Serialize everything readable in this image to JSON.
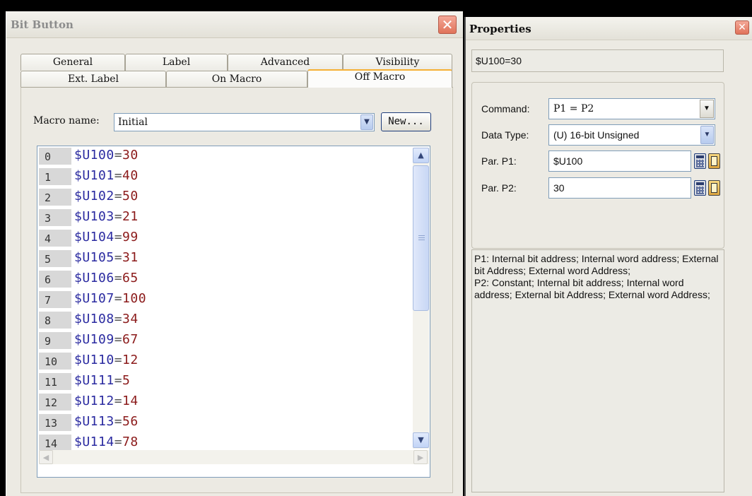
{
  "bit_button_dialog": {
    "title": "Bit Button",
    "tabs_row1": [
      "General",
      "Label",
      "Advanced",
      "Visibility"
    ],
    "tabs_row2": [
      "Ext. Label",
      "On Macro",
      "Off Macro"
    ],
    "active_tab": "Off Macro",
    "macro_name_label": "Macro name:",
    "macro_name_value": "Initial",
    "new_button_label": "New...",
    "macro_lines": [
      {
        "num": "0",
        "var": "$U100",
        "op": "=",
        "val": "30"
      },
      {
        "num": "1",
        "var": "$U101",
        "op": "=",
        "val": "40"
      },
      {
        "num": "2",
        "var": "$U102",
        "op": "=",
        "val": "50"
      },
      {
        "num": "3",
        "var": "$U103",
        "op": "=",
        "val": "21"
      },
      {
        "num": "4",
        "var": "$U104",
        "op": "=",
        "val": "99"
      },
      {
        "num": "5",
        "var": "$U105",
        "op": "=",
        "val": "31"
      },
      {
        "num": "6",
        "var": "$U106",
        "op": "=",
        "val": "65"
      },
      {
        "num": "7",
        "var": "$U107",
        "op": "=",
        "val": "100"
      },
      {
        "num": "8",
        "var": "$U108",
        "op": "=",
        "val": "34"
      },
      {
        "num": "9",
        "var": "$U109",
        "op": "=",
        "val": "67"
      },
      {
        "num": "10",
        "var": "$U110",
        "op": "=",
        "val": "12"
      },
      {
        "num": "11",
        "var": "$U111",
        "op": "=",
        "val": "5"
      },
      {
        "num": "12",
        "var": "$U112",
        "op": "=",
        "val": "14"
      },
      {
        "num": "13",
        "var": "$U113",
        "op": "=",
        "val": "56"
      },
      {
        "num": "14",
        "var": "$U114",
        "op": "=",
        "val": "78"
      }
    ]
  },
  "properties_panel": {
    "title": "Properties",
    "expression": "$U100=30",
    "command_label": "Command:",
    "command_value": "P1 = P2",
    "data_type_label": "Data Type:",
    "data_type_value": "(U) 16-bit Unsigned",
    "par_p1_label": "Par. P1:",
    "par_p1_value": "$U100",
    "par_p2_label": "Par. P2:",
    "par_p2_value": "30",
    "description": "P1: Internal bit address; Internal word address; External bit Address; External word Address;\nP2: Constant; Internal bit address; Internal word address; External bit Address; External word Address;"
  },
  "colors": {
    "active_tab_accent": "#f5b035",
    "close_button": "#e0735a",
    "macro_variable": "#2a2aa0",
    "macro_value": "#8b1a1a"
  }
}
